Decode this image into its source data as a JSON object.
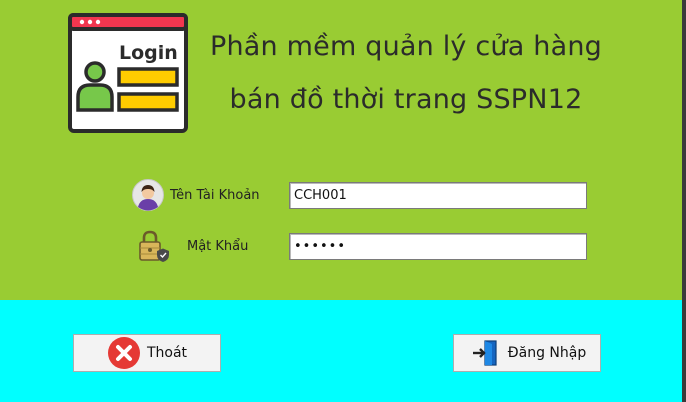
{
  "app": {
    "title_line1": "Phần mềm quản lý cửa hàng",
    "title_line2": "bán đồ thời trang SSPN12",
    "logo_text": "Login"
  },
  "form": {
    "username_label": "Tên Tài Khoản",
    "username_value": "CCH001",
    "password_label": "Mật Khẩu",
    "password_value": "••••••"
  },
  "buttons": {
    "exit_label": "Thoát",
    "login_label": "Đăng Nhập"
  },
  "icons": {
    "logo": "login-window-icon",
    "user": "user-avatar-icon",
    "password": "padlock-icon",
    "exit": "close-circle-icon",
    "login": "sign-in-door-icon"
  },
  "colors": {
    "top_panel": "#99cc33",
    "bottom_panel": "#00ffff",
    "logo_header": "#f2364f",
    "logo_bars": "#ffcc00",
    "logo_person": "#77c84a",
    "exit_icon": "#e53935"
  }
}
